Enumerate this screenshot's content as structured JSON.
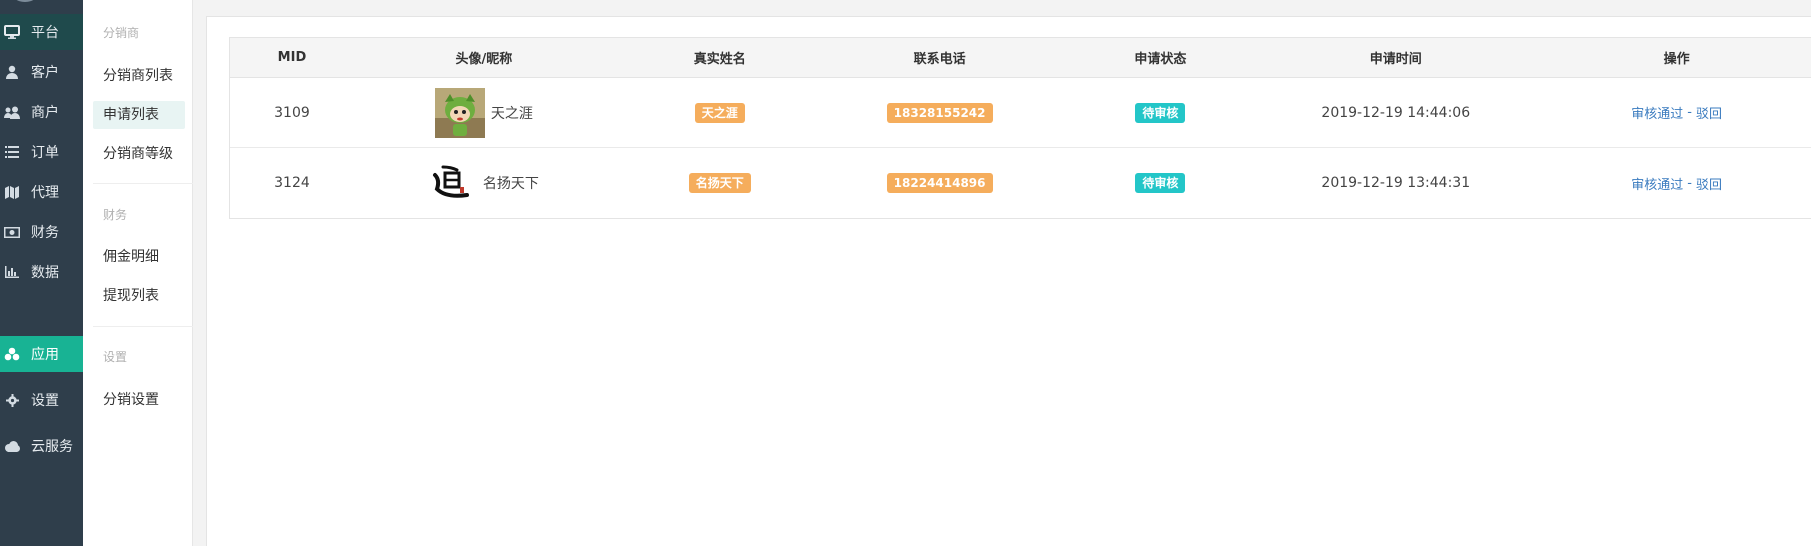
{
  "nav": {
    "items": [
      {
        "label": "平台",
        "icon": "monitor-icon"
      },
      {
        "label": "客户",
        "icon": "user-icon"
      },
      {
        "label": "商户",
        "icon": "users-icon"
      },
      {
        "label": "订单",
        "icon": "list-icon"
      },
      {
        "label": "代理",
        "icon": "map-icon"
      },
      {
        "label": "财务",
        "icon": "money-icon"
      },
      {
        "label": "数据",
        "icon": "bar-chart-icon"
      },
      {
        "label": "应用",
        "icon": "cubes-icon"
      },
      {
        "label": "设置",
        "icon": "gear-icon"
      },
      {
        "label": "云服务",
        "icon": "cloud-icon"
      }
    ]
  },
  "submenu": {
    "group1": "分销商",
    "item_list": "分销商列表",
    "item_apply": "申请列表",
    "item_level": "分销商等级",
    "group2": "财务",
    "item_commission": "佣金明细",
    "item_withdraw": "提现列表",
    "group3": "设置",
    "item_settings": "分销设置"
  },
  "table": {
    "headers": {
      "mid": "MID",
      "avatar": "头像/昵称",
      "realname": "真实姓名",
      "phone": "联系电话",
      "status": "申请状态",
      "time": "申请时间",
      "action": "操作"
    },
    "rows": [
      {
        "mid": "3109",
        "nickname": "天之涯",
        "realname": "天之涯",
        "phone": "18328155242",
        "status": "待审核",
        "time": "2019-12-19 14:44:06",
        "approve": "审核通过",
        "sep": "-",
        "reject": "驳回"
      },
      {
        "mid": "3124",
        "nickname": "名扬天下",
        "realname": "名扬天下",
        "phone": "18224414896",
        "status": "待审核",
        "time": "2019-12-19 13:44:31",
        "approve": "审核通过",
        "sep": "-",
        "reject": "驳回"
      }
    ]
  },
  "colors": {
    "nav_bg": "#2f3e4b",
    "accent": "#18b394",
    "badge_orange": "#f5ad5c",
    "badge_teal": "#23c6c8",
    "link": "#3a7bbf"
  }
}
